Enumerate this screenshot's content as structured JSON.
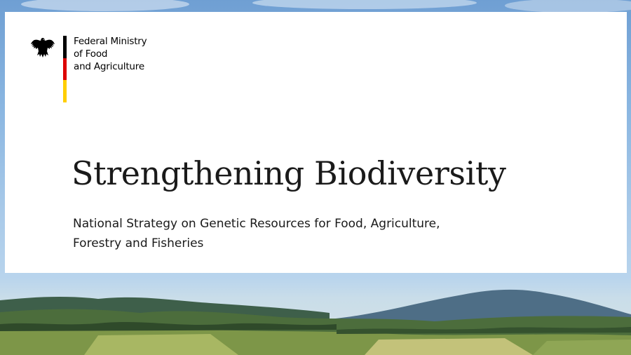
{
  "ministry": {
    "name_lines": [
      "Federal Ministry",
      "of Food",
      "and Agriculture"
    ],
    "flag_colors": [
      "#000000",
      "#dd0000",
      "#ffce00"
    ],
    "emblem_icon": "federal-eagle-icon"
  },
  "title": "Strengthening Biodiversity",
  "subtitle_lines": [
    "National Strategy on Genetic Resources for Food, Agriculture,",
    "Forestry and Fisheries"
  ],
  "colors": {
    "sky": "#8ab6e1",
    "card": "#ffffff",
    "text": "#1a1a1a"
  }
}
